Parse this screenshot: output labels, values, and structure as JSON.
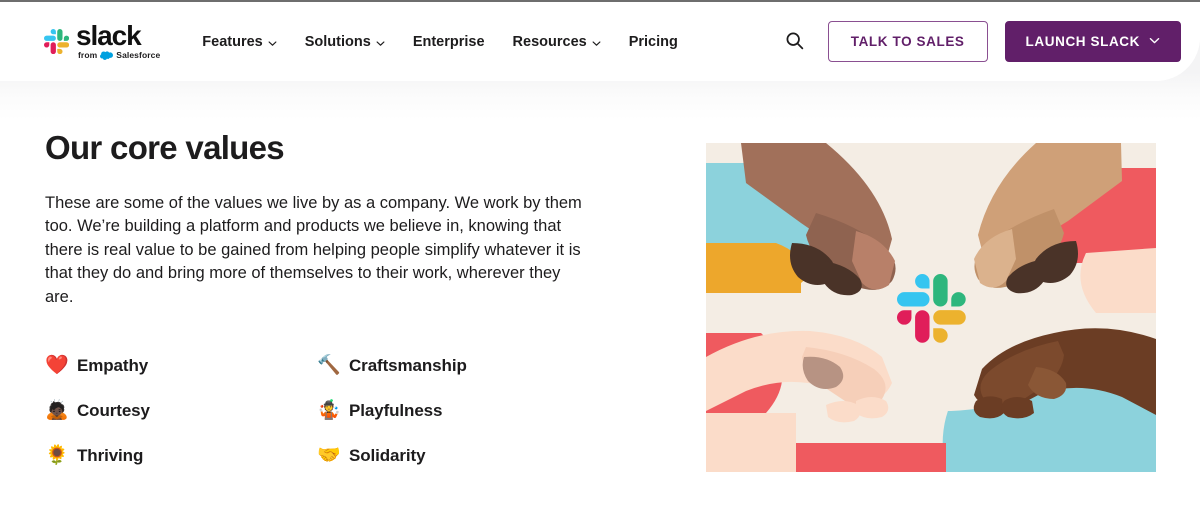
{
  "header": {
    "logo": {
      "wordmark": "slack",
      "from_label": "from",
      "parent_brand": "Salesforce",
      "mark_icon": "slack-hash-icon",
      "cloud_icon": "salesforce-cloud-icon"
    },
    "nav": [
      {
        "label": "Features",
        "has_dropdown": true
      },
      {
        "label": "Solutions",
        "has_dropdown": true
      },
      {
        "label": "Enterprise",
        "has_dropdown": false
      },
      {
        "label": "Resources",
        "has_dropdown": true
      },
      {
        "label": "Pricing",
        "has_dropdown": false
      }
    ],
    "search_icon": "search-icon",
    "talk_to_sales_label": "TALK TO SALES",
    "launch_slack_label": "LAUNCH SLACK",
    "launch_caret_icon": "chevron-down-icon"
  },
  "main": {
    "title": "Our core values",
    "body": "These are some of the values we live by as a company. We work by them too. We’re building a platform and products we believe in, knowing that there is real value to be gained from helping people simplify whatever it is that they do and bring more of themselves to their work, wherever they are.",
    "values": [
      {
        "emoji": "❤️",
        "icon": "heart-icon",
        "label": "Empathy"
      },
      {
        "emoji": "🔨",
        "icon": "hammer-icon",
        "label": "Craftsmanship"
      },
      {
        "emoji": "🙇🏿",
        "icon": "bowing-person-icon",
        "label": "Courtesy"
      },
      {
        "emoji": "🤹",
        "icon": "juggling-face-icon",
        "label": "Playfulness"
      },
      {
        "emoji": "🌻",
        "icon": "sunflower-icon",
        "label": "Thriving"
      },
      {
        "emoji": "🤝",
        "icon": "handshake-icon",
        "label": "Solidarity"
      }
    ],
    "illustration": {
      "name": "four-hands-holding-slack-logo-illustration",
      "alt": "Four hands of different skin tones reaching toward a central Slack logo"
    }
  },
  "colors": {
    "brand_purple": "#611f69",
    "page_text": "#1d1c1d",
    "header_background": "#ffffff",
    "page_background": "#ffffff",
    "backdrop_gray": "#f4f4f5",
    "slack_blue": "#36c5f0",
    "slack_green": "#2eb67d",
    "slack_red": "#e01e5a",
    "slack_yellow": "#ecb22e",
    "illo_cream": "#f4ede4",
    "illo_teal": "#8cd2dc",
    "illo_coral": "#ef5a5f",
    "illo_orange": "#eda72c"
  }
}
